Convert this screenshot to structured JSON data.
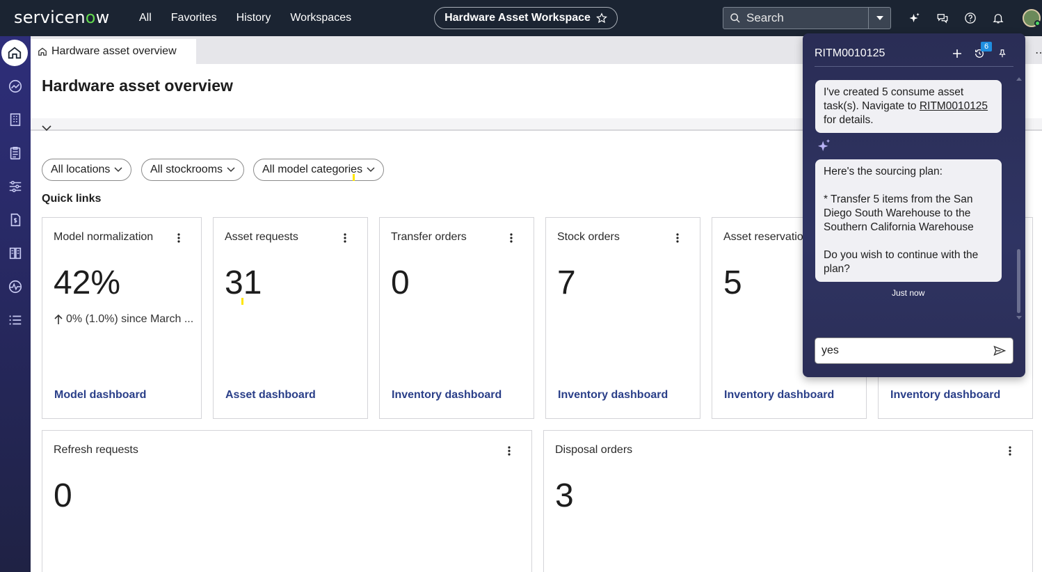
{
  "topnav": {
    "logo_text": "servicenow",
    "links": [
      "All",
      "Favorites",
      "History",
      "Workspaces"
    ],
    "workspace_title": "Hardware Asset Workspace",
    "search_placeholder": "Search"
  },
  "tab": {
    "label": "Hardware asset overview"
  },
  "page": {
    "title": "Hardware asset overview"
  },
  "filters": [
    "All locations",
    "All stockrooms",
    "All model categories"
  ],
  "quick_links_label": "Quick links",
  "cards_row1": [
    {
      "title": "Model normalization",
      "value": "42%",
      "sub": "0% (1.0%) since March ...",
      "link": "Model dashboard"
    },
    {
      "title": "Asset requests",
      "value": "31",
      "link": "Asset dashboard"
    },
    {
      "title": "Transfer orders",
      "value": "0",
      "link": "Inventory dashboard"
    },
    {
      "title": "Stock orders",
      "value": "7",
      "link": "Inventory dashboard"
    },
    {
      "title": "Asset reservatio",
      "value": "5",
      "link": "Inventory dashboard"
    },
    {
      "link": "Inventory dashboard"
    }
  ],
  "cards_row2": [
    {
      "title": "Refresh requests",
      "value": "0"
    },
    {
      "title": "Disposal orders",
      "value": "3"
    }
  ],
  "assistant": {
    "title": "RITM0010125",
    "history_count": "6",
    "msg1_a": "I've created 5 consume asset task(s). Navigate to ",
    "msg1_link": "RITM0010125",
    "msg1_b": " for details.",
    "msg2_l1": "Here's the sourcing plan:",
    "msg2_l2": "* Transfer 5 items from the San Diego South Warehouse to the Southern California Warehouse",
    "msg2_l3": "Do you wish to continue with the plan?",
    "timestamp": "Just now",
    "input_value": "yes"
  }
}
